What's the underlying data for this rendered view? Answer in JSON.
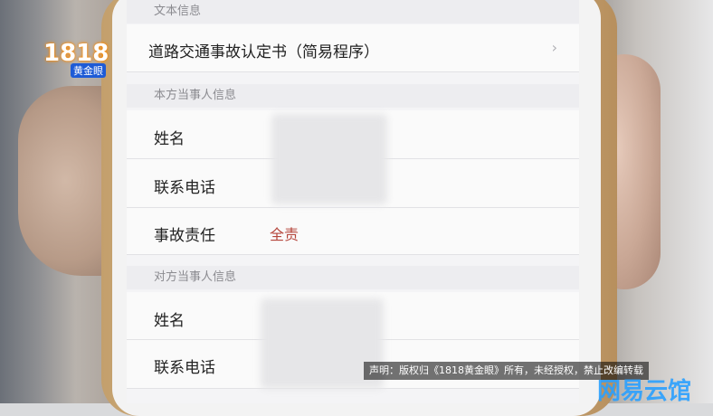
{
  "screen": {
    "section_doc": "文本信息",
    "doc_row": {
      "label": "道路交通事故认定书（简易程序）",
      "chevron": "›"
    },
    "section_own": "本方当事人信息",
    "own_rows": [
      {
        "label": "姓名"
      },
      {
        "label": "联系电话"
      },
      {
        "label": "事故责任",
        "value": "全责"
      }
    ],
    "section_other": "对方当事人信息",
    "other_rows": [
      {
        "label": "姓名"
      },
      {
        "label": "联系电话"
      }
    ]
  },
  "overlays": {
    "logo_number": "1818",
    "logo_tag": "黄金眼",
    "notice": "声明：版权归《1818黄金眼》所有，未经授权，禁止改编转载",
    "watermark": "网易云馆"
  },
  "colors": {
    "responsibility_text": "#b5463c",
    "section_header_bg": "#ededf0"
  }
}
